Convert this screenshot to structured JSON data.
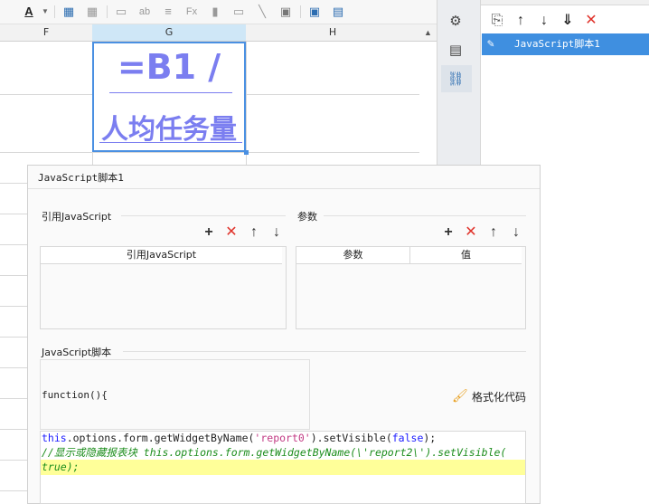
{
  "spreadsheet": {
    "columns": [
      "F",
      "G",
      "H"
    ],
    "cell": {
      "line1": "=B1 /",
      "line2": "人均任务量"
    }
  },
  "right_panel": {
    "item": "JavaScript脚本1"
  },
  "dialog": {
    "title": "JavaScript脚本1",
    "ref_section": {
      "label": "引用JavaScript",
      "column": "引用JavaScript"
    },
    "param_section": {
      "label": "参数",
      "columns": [
        "参数",
        "值"
      ]
    },
    "script_section": {
      "label": "JavaScript脚本",
      "function_header": "function(){",
      "format_button": "格式化代码",
      "code": {
        "l1_kw": "this",
        "l1_a": ".options.form.getWidgetByName(",
        "l1_str": "'report0'",
        "l1_b": ").setVisible(",
        "l1_kw2": "false",
        "l1_c": ");",
        "l2": "//显示或隐藏报表块 this.options.form.getWidgetByName(\\'report2\\').setVisible(",
        "l3": "true);"
      }
    }
  }
}
